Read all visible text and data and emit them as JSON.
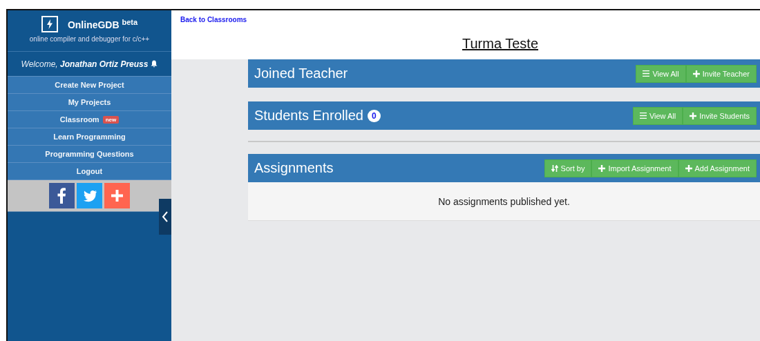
{
  "sidebar": {
    "logo": {
      "name": "OnlineGDB",
      "tag": "beta",
      "subtitle": "online compiler and debugger for c/c++"
    },
    "welcome": {
      "prefix": "Welcome,",
      "user": "Jonathan Ortiz Preuss"
    },
    "items": [
      {
        "label": "Create New Project"
      },
      {
        "label": "My Projects"
      },
      {
        "label": "Classroom",
        "badge": "new"
      },
      {
        "label": "Learn Programming"
      },
      {
        "label": "Programming Questions"
      },
      {
        "label": "Logout"
      }
    ],
    "social": [
      {
        "kind": "facebook"
      },
      {
        "kind": "twitter"
      },
      {
        "kind": "share"
      }
    ]
  },
  "main": {
    "back_link": "Back to Classrooms",
    "title": "Turma Teste",
    "panels": [
      {
        "title": "Joined Teacher",
        "buttons": [
          {
            "kind": "list",
            "label": "View All"
          },
          {
            "kind": "plus",
            "label": "Invite Teacher"
          }
        ]
      },
      {
        "title": "Students Enrolled",
        "count": "0",
        "buttons": [
          {
            "kind": "list",
            "label": "View All"
          },
          {
            "kind": "plus",
            "label": "Invite Students"
          }
        ]
      },
      {
        "title": "Assignments",
        "divider_above": true,
        "buttons": [
          {
            "kind": "sort",
            "label": "Sort by"
          },
          {
            "kind": "plus",
            "label": "Import Assignment"
          },
          {
            "kind": "plus",
            "label": "Add Assignment"
          }
        ],
        "message": "No assignments published yet."
      }
    ]
  }
}
